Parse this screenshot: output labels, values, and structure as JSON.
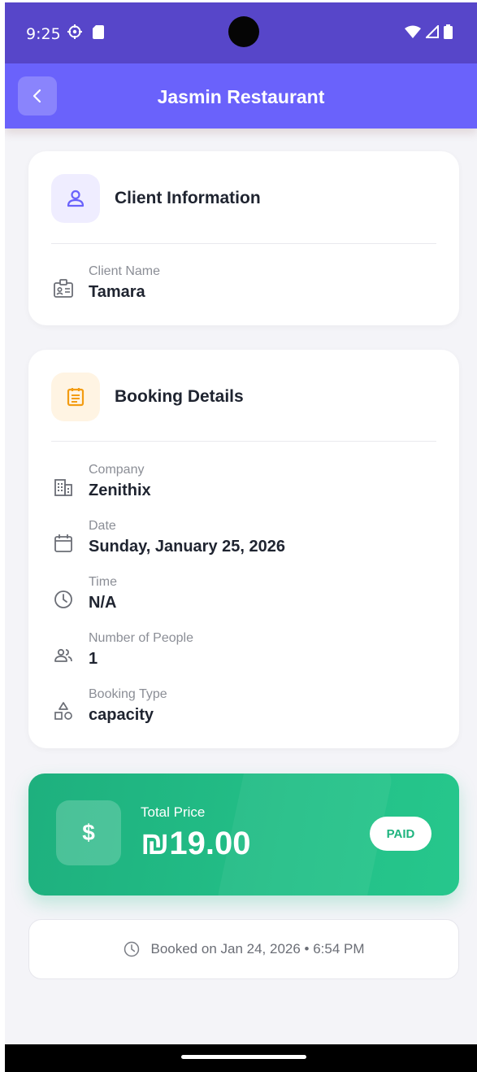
{
  "status_bar": {
    "time": "9:25"
  },
  "app_bar": {
    "title": "Jasmin Restaurant"
  },
  "client_card": {
    "title": "Client Information",
    "client_name_label": "Client Name",
    "client_name_value": "Tamara"
  },
  "booking_card": {
    "title": "Booking Details",
    "rows": [
      {
        "label": "Company",
        "value": "Zenithix",
        "icon": "building-icon"
      },
      {
        "label": "Date",
        "value": "Sunday, January 25, 2026",
        "icon": "calendar-icon"
      },
      {
        "label": "Time",
        "value": "N/A",
        "icon": "clock-icon"
      },
      {
        "label": "Number of People",
        "value": "1",
        "icon": "people-icon"
      },
      {
        "label": "Booking Type",
        "value": "capacity",
        "icon": "shapes-icon"
      }
    ]
  },
  "price_card": {
    "label": "Total Price",
    "value": "₪19.00",
    "status": "PAID",
    "icon_glyph": "$"
  },
  "booked_info": {
    "text": "Booked on Jan 24, 2026 • 6:54 PM"
  },
  "colors": {
    "status_bar": "#5746c9",
    "app_bar": "#6a62fb",
    "accent_purple": "#6a62fb",
    "accent_orange": "#f39c12",
    "price_green": "#23bf87"
  }
}
